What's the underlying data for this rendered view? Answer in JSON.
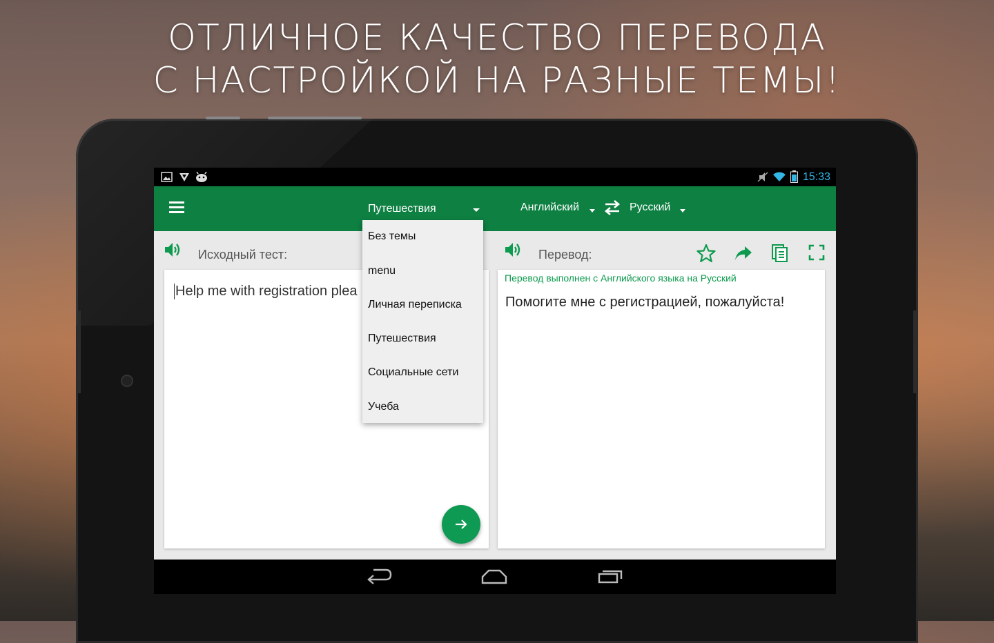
{
  "headline": {
    "line1": "ОТЛИЧНОЕ КАЧЕСТВО ПЕРЕВОДА",
    "line2": "С НАСТРОЙКОЙ НА РАЗНЫЕ ТЕМЫ!"
  },
  "status_bar": {
    "time": "15:33",
    "icons": [
      "image-notification-icon",
      "shield-notification-icon",
      "android-notification-icon",
      "mute-icon",
      "wifi-icon",
      "battery-icon"
    ]
  },
  "toolbar": {
    "topic": "Путешествия",
    "source_language": "Английский",
    "target_language": "Русский",
    "accent_color": "#0e8042"
  },
  "source_panel": {
    "label": "Исходный тест:",
    "text": "Help me with registration plea"
  },
  "target_panel": {
    "label": "Перевод:",
    "info": "Перевод выполнен с Английского языка на Русский",
    "text": "Помогите мне с регистрацией, пожалуйста!"
  },
  "topic_menu": {
    "items": [
      "Без темы",
      "menu",
      "Личная переписка",
      "Путешествия",
      "Социальные сети",
      "Учеба"
    ]
  }
}
